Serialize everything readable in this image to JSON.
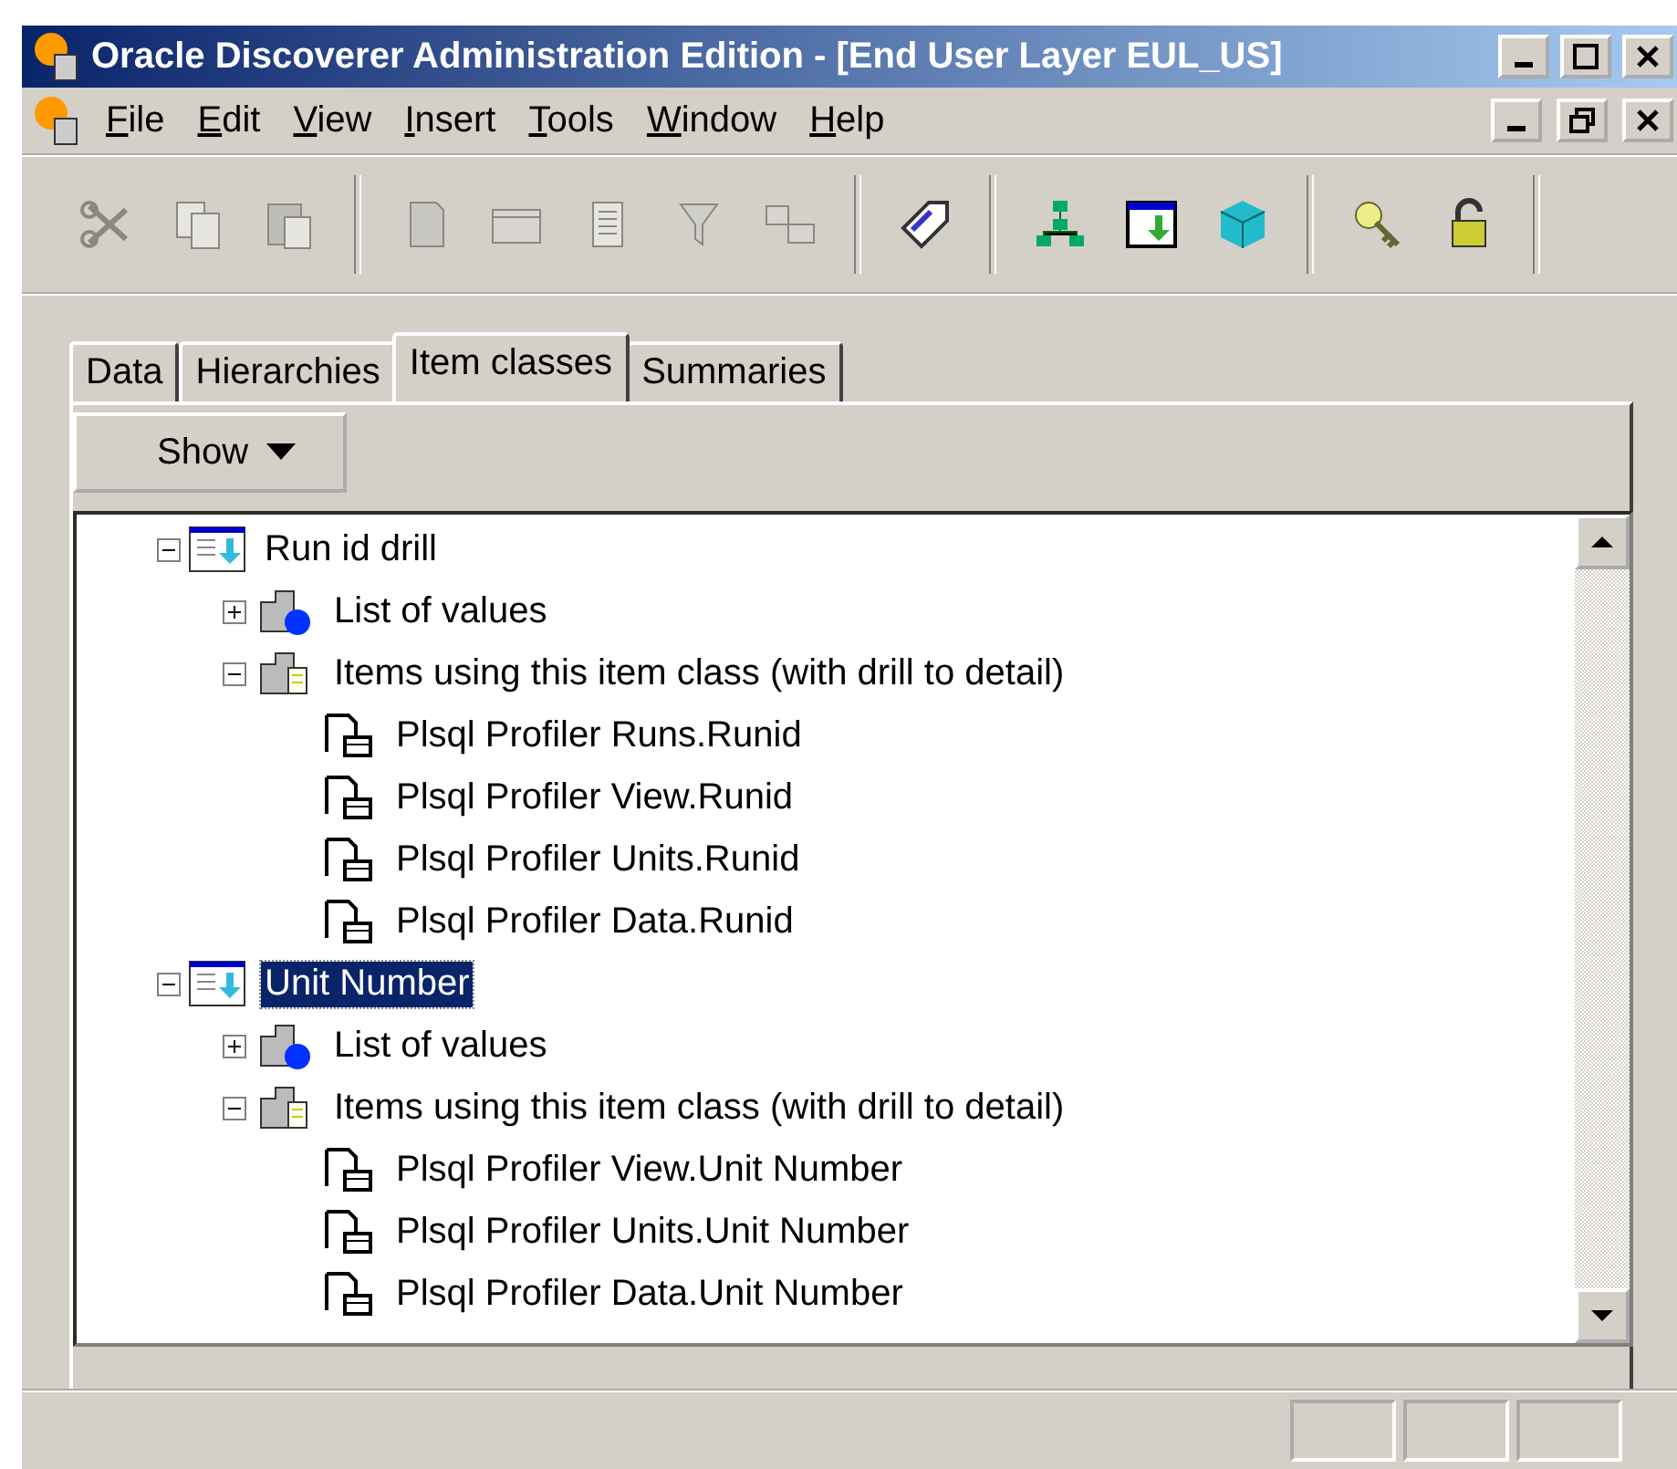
{
  "window": {
    "title": "Oracle Discoverer Administration Edition - [End User Layer  EUL_US]"
  },
  "menu": [
    "File",
    "Edit",
    "View",
    "Insert",
    "Tools",
    "Window",
    "Help"
  ],
  "toolbar": [
    [
      {
        "kind": "cut",
        "disabled": true
      },
      {
        "kind": "copy",
        "disabled": true
      },
      {
        "kind": "paste",
        "disabled": true
      }
    ],
    [
      {
        "kind": "folder",
        "disabled": true
      },
      {
        "kind": "table",
        "disabled": true
      },
      {
        "kind": "list",
        "disabled": true
      },
      {
        "kind": "filter",
        "disabled": true
      },
      {
        "kind": "join",
        "disabled": true
      }
    ],
    [
      {
        "kind": "tag",
        "disabled": false
      }
    ],
    [
      {
        "kind": "hierarchy",
        "disabled": false
      },
      {
        "kind": "drill",
        "disabled": false
      },
      {
        "kind": "cube",
        "disabled": false
      }
    ],
    [
      {
        "kind": "key",
        "disabled": false
      },
      {
        "kind": "lock",
        "disabled": false
      }
    ]
  ],
  "tabs": [
    {
      "label": "Data",
      "selected": false
    },
    {
      "label": "Hierarchies",
      "selected": false
    },
    {
      "label": "Item classes",
      "selected": true
    },
    {
      "label": "Summaries",
      "selected": false
    }
  ],
  "show_button": {
    "label": "Show"
  },
  "tree": [
    {
      "label": "Run id drill",
      "kind": "drill",
      "expanded": true,
      "selected": false,
      "children": [
        {
          "label": "List of values",
          "kind": "lov",
          "expanded": false,
          "selected": false
        },
        {
          "label": "Items using this item class (with drill to detail)",
          "kind": "items",
          "expanded": true,
          "selected": false,
          "children": [
            {
              "label": "Plsql Profiler Runs.Runid",
              "kind": "item",
              "selected": false
            },
            {
              "label": "Plsql Profiler View.Runid",
              "kind": "item",
              "selected": false
            },
            {
              "label": "Plsql Profiler Units.Runid",
              "kind": "item",
              "selected": false
            },
            {
              "label": "Plsql Profiler Data.Runid",
              "kind": "item",
              "selected": false
            }
          ]
        }
      ]
    },
    {
      "label": "Unit Number",
      "kind": "drill",
      "expanded": true,
      "selected": true,
      "children": [
        {
          "label": "List of values",
          "kind": "lov",
          "expanded": false,
          "selected": false
        },
        {
          "label": "Items using this item class (with drill to detail)",
          "kind": "items",
          "expanded": true,
          "selected": false,
          "children": [
            {
              "label": "Plsql Profiler View.Unit Number",
              "kind": "item",
              "selected": false
            },
            {
              "label": "Plsql Profiler Units.Unit Number",
              "kind": "item",
              "selected": false
            },
            {
              "label": "Plsql Profiler Data.Unit Number",
              "kind": "item",
              "selected": false
            }
          ]
        }
      ]
    }
  ]
}
